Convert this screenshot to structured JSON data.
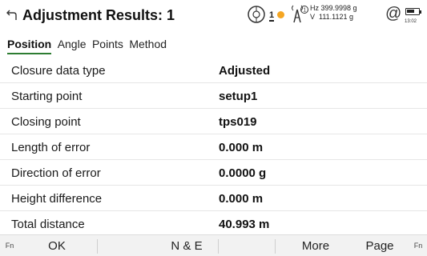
{
  "header": {
    "title": "Adjustment Results: 1",
    "back_icon": "back-arrow-icon"
  },
  "status": {
    "target_icon": "prism-target-icon",
    "face_number": "1",
    "sun_icon": "sun-icon",
    "antenna_icon": "antenna-icon",
    "antenna_index": "1",
    "hz_line": "Hz 399.9998 g",
    "v_line": "V  111.1121 g",
    "at_icon": "at-sign-icon",
    "battery_icon": "battery-icon",
    "time": "13:02"
  },
  "tabs": [
    {
      "label": "Position",
      "active": true
    },
    {
      "label": "Angle",
      "active": false
    },
    {
      "label": "Points",
      "active": false
    },
    {
      "label": "Method",
      "active": false
    }
  ],
  "rows": [
    {
      "label": "Closure data type",
      "value": "Adjusted"
    },
    {
      "label": "Starting point",
      "value": "setup1"
    },
    {
      "label": "Closing point",
      "value": "tps019"
    },
    {
      "label": "Length of error",
      "value": "0.000 m"
    },
    {
      "label": "Direction of error",
      "value": "0.0000 g"
    },
    {
      "label": "Height difference",
      "value": "0.000 m"
    },
    {
      "label": "Total distance",
      "value": "40.993 m"
    }
  ],
  "softkeys": {
    "fn_left": "Fn",
    "ok": "OK",
    "ne": "N & E",
    "more": "More",
    "page": "Page",
    "fn_right": "Fn"
  },
  "colors": {
    "accent_underline": "#2e7d32",
    "sun": "#f5a623",
    "softkey_bar": "#f2f2f2"
  }
}
